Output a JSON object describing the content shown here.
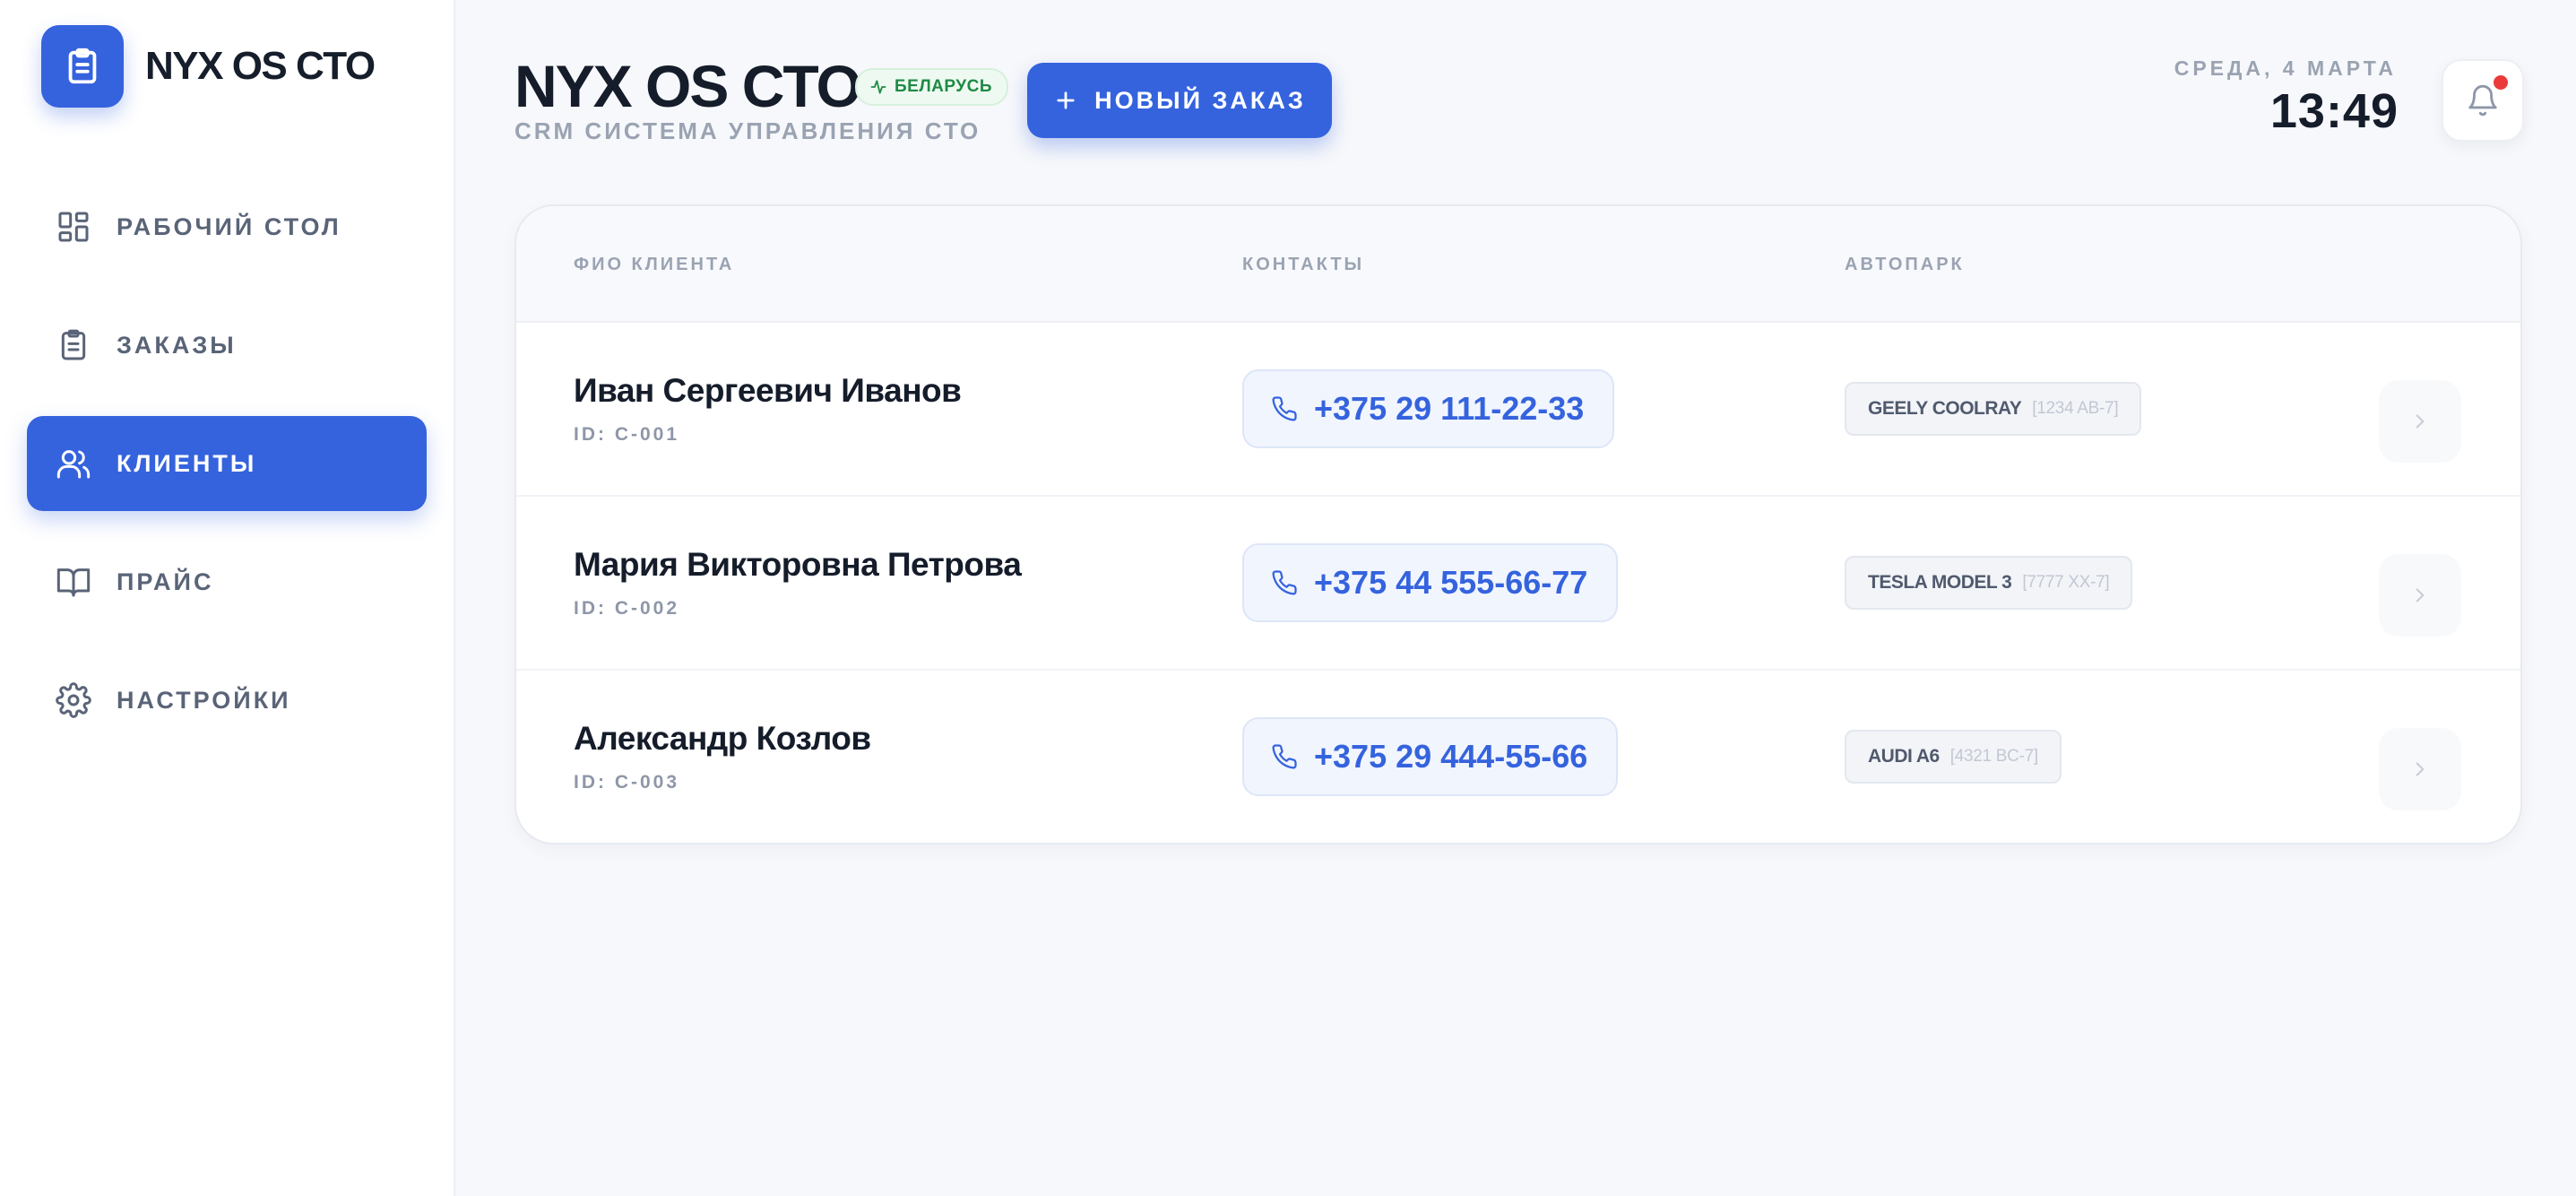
{
  "app": {
    "logo_text": "NYX OS CTO",
    "title": "NYX OS CTO",
    "badge": "БЕЛАРУСЬ",
    "subtitle": "CRM СИСТЕМА УПРАВЛЕНИЯ СТО"
  },
  "sidebar": {
    "items": [
      {
        "label": "РАБОЧИЙ СТОЛ",
        "icon": "dashboard-icon",
        "active": false
      },
      {
        "label": "ЗАКАЗЫ",
        "icon": "clipboard-icon",
        "active": false
      },
      {
        "label": "КЛИЕНТЫ",
        "icon": "users-icon",
        "active": true
      },
      {
        "label": "ПРАЙС",
        "icon": "book-icon",
        "active": false
      },
      {
        "label": "НАСТРОЙКИ",
        "icon": "gear-icon",
        "active": false
      }
    ]
  },
  "header": {
    "new_order_label": "НОВЫЙ ЗАКАЗ",
    "date": "СРЕДА, 4 МАРТА",
    "time": "13:49",
    "notification_icon": "bell-icon",
    "has_notifications": true
  },
  "table": {
    "columns": [
      "ФИО КЛИЕНТА",
      "КОНТАКТЫ",
      "АВТОПАРК"
    ],
    "rows": [
      {
        "name": "Иван Сергеевич Иванов",
        "id": "ID: C-001",
        "phone": "+375 29 111-22-33",
        "car_model": "GEELY COOLRAY",
        "car_plate": "[1234 AB-7]"
      },
      {
        "name": "Мария Викторовна Петрова",
        "id": "ID: C-002",
        "phone": "+375 44 555-66-77",
        "car_model": "TESLA MODEL 3",
        "car_plate": "[7777 XX-7]"
      },
      {
        "name": "Александр Козлов",
        "id": "ID: C-003",
        "phone": "+375 29 444-55-66",
        "car_model": "AUDI A6",
        "car_plate": "[4321 BC-7]"
      }
    ]
  },
  "colors": {
    "accent": "#3563de",
    "badge_green": "#1f8a45",
    "notification_dot": "#ea3a3a"
  }
}
